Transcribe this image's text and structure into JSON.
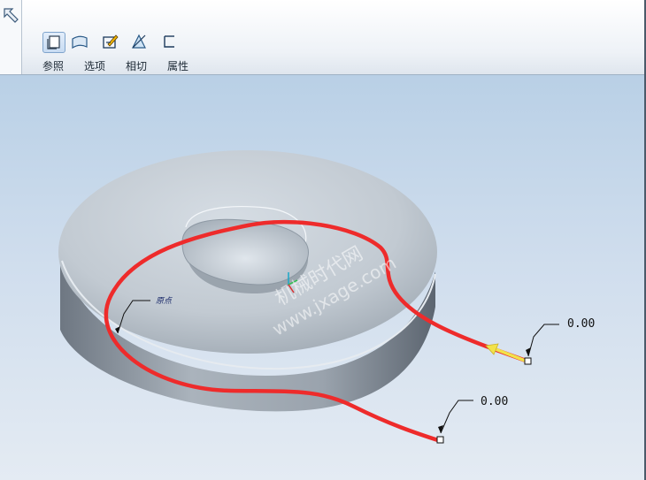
{
  "toolbar": {
    "tabs": [
      {
        "label": "参照",
        "icon": "reference-icon",
        "active": true
      },
      {
        "label": "选项",
        "icon": "options-icon",
        "active": false
      },
      {
        "label": "相切",
        "icon": "tangent-icon",
        "active": false
      },
      {
        "label": "属性",
        "icon": "properties-icon",
        "active": false
      }
    ],
    "back_icon": "back-arrow-icon"
  },
  "viewport": {
    "dimension_1": "0.00",
    "dimension_2": "0.00",
    "point_label": "原点",
    "watermark_line1": "机械时代网",
    "watermark_line2": "www.jxage.com"
  },
  "colors": {
    "curve": "#ee2b2b",
    "direction_arrow": "#f2e24a",
    "part_body": "#b4bdc6"
  }
}
